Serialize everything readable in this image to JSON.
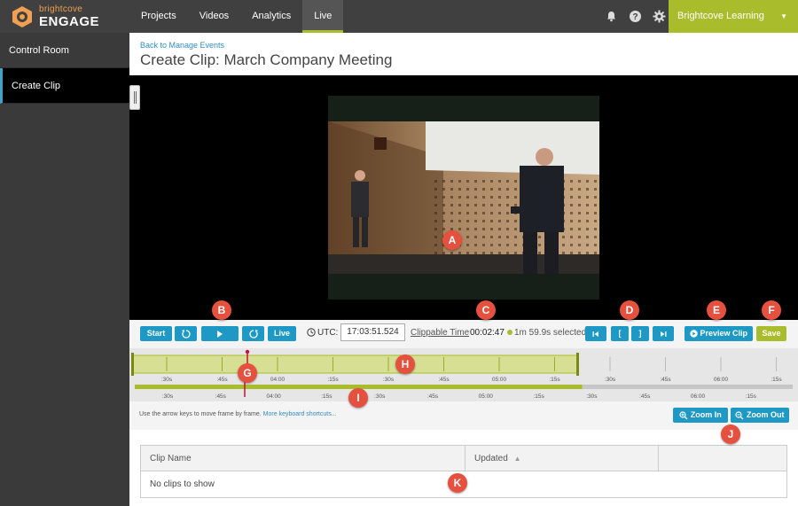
{
  "brand": {
    "small": "brightcove",
    "big": "ENGAGE",
    "accent": "#f0a050"
  },
  "nav": {
    "items": [
      {
        "label": "Projects"
      },
      {
        "label": "Videos"
      },
      {
        "label": "Analytics"
      },
      {
        "label": "Live"
      }
    ],
    "active": "Live"
  },
  "top_icons": [
    "bell-icon",
    "help-icon",
    "gear-icon"
  ],
  "account": {
    "label": "Brightcove Learning Engage",
    "caret": "▼"
  },
  "sidebar": {
    "items": [
      {
        "label": "Control Room"
      },
      {
        "label": "Create Clip"
      }
    ],
    "active": "Create Clip"
  },
  "header": {
    "back_link": "Back to Manage Events",
    "title": "Create Clip: March Company Meeting"
  },
  "controls": {
    "start_label": "Start",
    "live_label": "Live",
    "utc_label": "UTC:",
    "utc_value": "17:03:51.524",
    "clippable_label": "Clippable Time",
    "clippable_value": "00:02:47",
    "selected_text": "1m 59.9s selected",
    "mark_in": "[",
    "mark_out": "]",
    "preview_label": "Preview Clip",
    "save_label": "Save"
  },
  "timeline": {
    "upper_ticks": [
      ":30s",
      ":45s",
      "04:00",
      ":15s",
      ":30s",
      ":45s",
      "05:00",
      ":15s",
      ":30s",
      ":45s",
      "06:00",
      ":15s"
    ],
    "lower_ticks": [
      ":30s",
      ":45s",
      "04:00",
      ":15s",
      ":30s",
      ":45s",
      "05:00",
      ":15s",
      ":30s",
      ":45s",
      "06:00",
      ":15s"
    ],
    "selection_fraction": 0.68
  },
  "hint": {
    "text": "Use the arrow keys to move frame by frame.",
    "link": "More keyboard shortcuts..."
  },
  "zoom": {
    "in_label": "Zoom In",
    "out_label": "Zoom Out"
  },
  "table": {
    "columns": [
      "Clip Name",
      "Updated"
    ],
    "sort_indicator": "▲",
    "empty": "No clips to show"
  },
  "callouts": [
    "A",
    "B",
    "C",
    "D",
    "E",
    "F",
    "G",
    "H",
    "I",
    "J",
    "K"
  ],
  "colors": {
    "primary": "#1e98c4",
    "accent_green": "#a9bd2c",
    "callout": "#e6503f",
    "topbar": "#404040"
  }
}
